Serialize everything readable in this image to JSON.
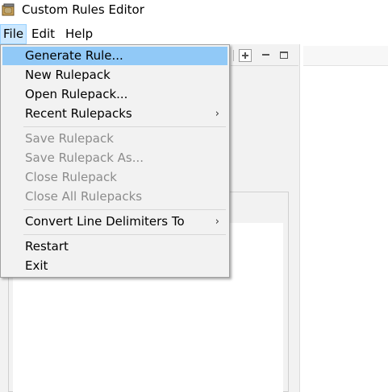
{
  "app": {
    "title": "Custom Rules Editor",
    "icon": "app-icon"
  },
  "menubar": {
    "items": [
      {
        "label": "File",
        "active": true
      },
      {
        "label": "Edit",
        "active": false
      },
      {
        "label": "Help",
        "active": false
      }
    ]
  },
  "file_menu": {
    "items": [
      {
        "label": "Generate Rule...",
        "enabled": true,
        "highlighted": true,
        "submenu": false
      },
      {
        "label": "New Rulepack",
        "enabled": true,
        "highlighted": false,
        "submenu": false
      },
      {
        "label": "Open Rulepack...",
        "enabled": true,
        "highlighted": false,
        "submenu": false
      },
      {
        "label": "Recent Rulepacks",
        "enabled": true,
        "highlighted": false,
        "submenu": true
      },
      {
        "label": "Save Rulepack",
        "enabled": false,
        "highlighted": false,
        "submenu": false
      },
      {
        "label": "Save Rulepack As...",
        "enabled": false,
        "highlighted": false,
        "submenu": false
      },
      {
        "label": "Close Rulepack",
        "enabled": false,
        "highlighted": false,
        "submenu": false
      },
      {
        "label": "Close All Rulepacks",
        "enabled": false,
        "highlighted": false,
        "submenu": false
      },
      {
        "label": "Convert Line Delimiters To",
        "enabled": true,
        "highlighted": false,
        "submenu": true
      },
      {
        "label": "Restart",
        "enabled": true,
        "highlighted": false,
        "submenu": false
      },
      {
        "label": "Exit",
        "enabled": true,
        "highlighted": false,
        "submenu": false
      }
    ],
    "submenu_arrow": "›"
  },
  "view_toolbar": {
    "icons": [
      "add-view-icon",
      "minimize-icon",
      "maximize-icon"
    ]
  },
  "colors": {
    "highlight": "#91c9f7",
    "menu_background": "#f2f2f2",
    "disabled_text": "#8c8c8c",
    "active_menubar": "#cce8ff"
  }
}
